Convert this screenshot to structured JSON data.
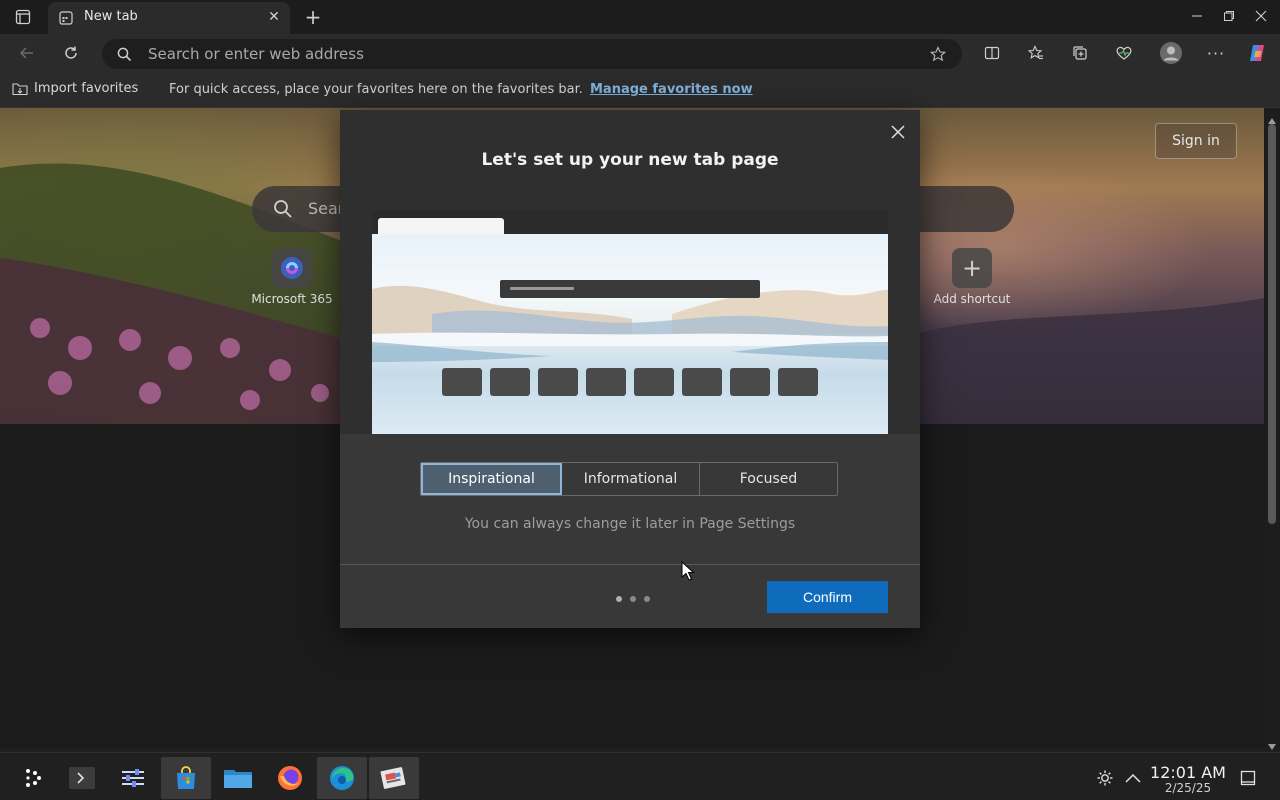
{
  "browser": {
    "tab_title": "New tab",
    "address_placeholder": "Search or enter web address"
  },
  "favorites_bar": {
    "import_label": "Import favorites",
    "message": "For quick access, place your favorites here on the favorites bar.",
    "manage_link": "Manage favorites now"
  },
  "newtab": {
    "sign_in": "Sign in",
    "search_placeholder": "Sear",
    "shortcuts": [
      {
        "label": "Microsoft 365",
        "icon": "copilot-icon"
      },
      {
        "label": "Add shortcut",
        "icon": "plus-icon"
      }
    ]
  },
  "dialog": {
    "title": "Let's set up your new tab page",
    "layout_options": [
      "Inspirational",
      "Informational",
      "Focused"
    ],
    "selected_option": "Inspirational",
    "hint": "You can always change it later in Page Settings",
    "confirm_label": "Confirm",
    "step_count": 3
  },
  "taskbar": {
    "time": "12:01 AM",
    "date": "2/25/25",
    "apps": [
      "start-icon",
      "terminal-icon",
      "settings-icon",
      "store-icon",
      "file-manager-icon",
      "firefox-icon",
      "edge-icon",
      "app-icon"
    ]
  },
  "colors": {
    "accent": "#0f6cbd",
    "link": "#7fb0d8",
    "selected_option_bg": "#4e5f70"
  }
}
